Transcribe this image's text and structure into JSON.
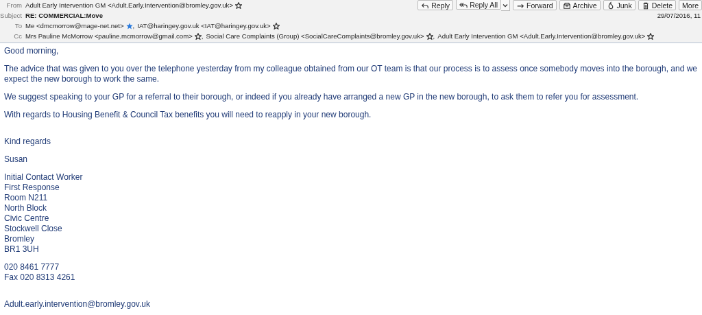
{
  "header": {
    "buttons": [
      {
        "kind": "reply",
        "label": "Reply"
      },
      {
        "kind": "reply-all",
        "label": "Reply All",
        "dropdown": true
      },
      {
        "kind": "forward",
        "label": "Forward"
      },
      {
        "kind": "archive",
        "label": "Archive"
      },
      {
        "kind": "junk",
        "label": "Junk"
      },
      {
        "kind": "delete",
        "label": "Delete"
      },
      {
        "kind": "more",
        "label": "More"
      }
    ],
    "from": {
      "label": "From",
      "people": [
        {
          "text": "Adult Early Intervention GM <Adult.Early.Intervention@bromley.gov.uk>",
          "starred": false
        }
      ]
    },
    "subject": {
      "label": "Subject",
      "text": "RE: COMMERCIAL:Move"
    },
    "date": "29/07/2016, 11",
    "to": {
      "label": "To",
      "people": [
        {
          "text": "Me <dmcmorrow@mage-net.net>",
          "starred": true
        },
        {
          "sep": ",",
          "text": "IAT@haringey.gov.uk <IAT@haringey.gov.uk>",
          "starred": false
        }
      ]
    },
    "cc": {
      "label": "Cc",
      "people": [
        {
          "text": "Mrs Pauline McMorrow <pauline.mcmorrow@gmail.com>",
          "starred": false
        },
        {
          "sep": ",",
          "text": "Social Care Complaints (Group) <SocialCareComplaints@bromley.gov.uk>",
          "starred": false
        },
        {
          "sep": ",",
          "text": "Adult Early Intervention GM <Adult.Early.Intervention@bromley.gov.uk>",
          "starred": false
        }
      ]
    }
  },
  "body": [
    {
      "kind": "first",
      "lines": [
        "Good morning,"
      ]
    },
    {
      "kind": "para",
      "lines": [
        "The advice that was given to you over the telephone yesterday from my colleague obtained from our OT team is that our process is to assess once somebody moves into the borough, and we expect the new borough to work the same."
      ]
    },
    {
      "kind": "para",
      "lines": [
        "We suggest speaking to your GP for a referral to their borough, or indeed if you already have arranged a new GP in the new borough, to ask them to refer you for assessment."
      ]
    },
    {
      "kind": "para",
      "lines": [
        "With regards to Housing Benefit & Council Tax benefits you will need to reapply in your new borough."
      ]
    },
    {
      "kind": "closing",
      "lines": [
        "Kind regards"
      ]
    },
    {
      "kind": "para",
      "lines": [
        "Susan"
      ]
    },
    {
      "kind": "para",
      "lines": [
        "Initial Contact Worker",
        "First Response",
        "Room N211",
        "North Block",
        "Civic Centre",
        "Stockwell Close",
        "Bromley",
        "BR1 3UH"
      ]
    },
    {
      "kind": "para",
      "lines": [
        "020 8461 7777",
        "Fax 020 8313 4261"
      ]
    },
    {
      "kind": "closing",
      "lines": [
        "Adult.early.intervention@bromley.gov.uk"
      ]
    }
  ]
}
